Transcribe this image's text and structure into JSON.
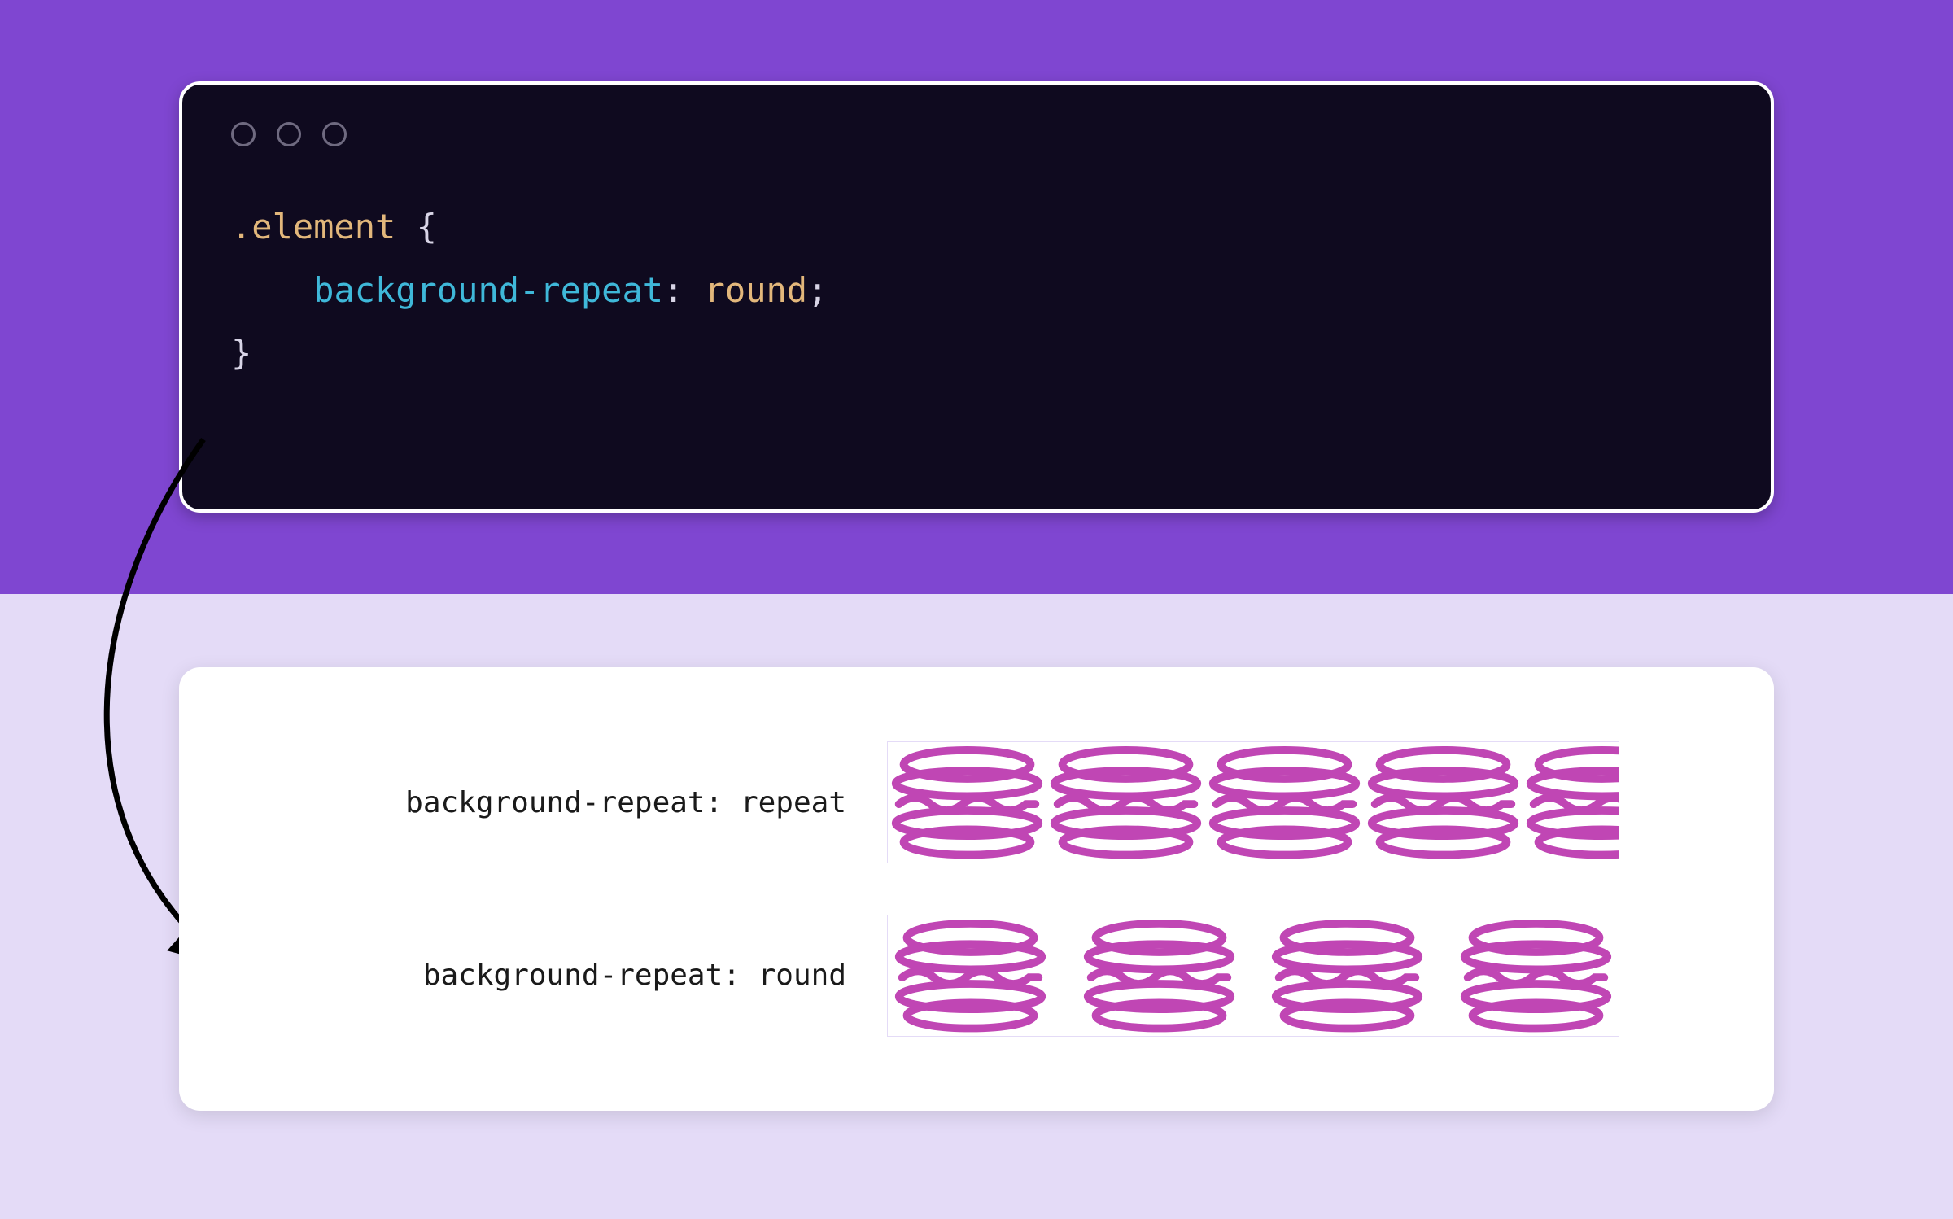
{
  "colors": {
    "purple_bg": "#7f46d1",
    "lavender_bg": "#e4dbf7",
    "code_bg": "#0f0a1f",
    "card_bg": "#ffffff",
    "icon_stroke": "#c046b4",
    "arrow_stroke": "#000000"
  },
  "code": {
    "selector": ".element",
    "open_brace": "{",
    "property": "background-repeat",
    "colon": ":",
    "value": "round",
    "semicolon": ";",
    "close_brace": "}"
  },
  "demo": {
    "row1_label": "background-repeat: repeat",
    "row2_label": "background-repeat: round",
    "repeat_count": 5,
    "round_count": 4,
    "repeat_last_clipped": true
  },
  "icon": {
    "name": "macaron-icon"
  }
}
